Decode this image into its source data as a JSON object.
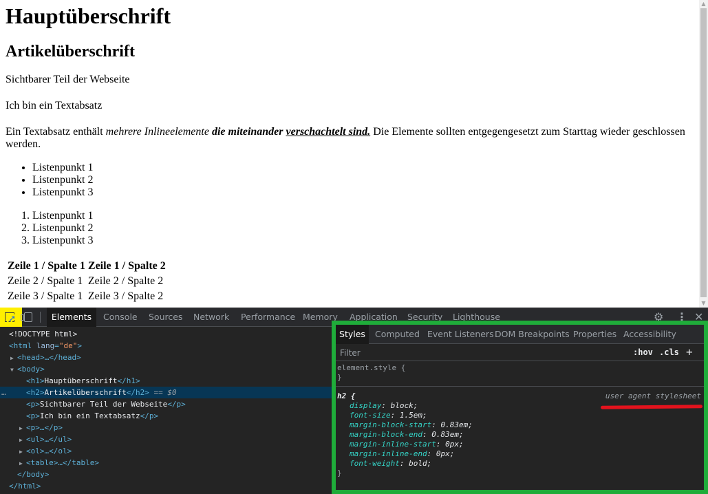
{
  "page": {
    "h1": "Hauptüberschrift",
    "h2": "Artikelüberschrift",
    "p1": "Sichtbarer Teil der Webseite",
    "p2": "Ich bin ein Textabsatz",
    "p3": {
      "part1": "Ein Textabsatz enthält ",
      "em": "mehrere Inlineelemente",
      "space1": " ",
      "strong": "die miteinander ",
      "strong_u": "verschachtelt sind.",
      "part2": " Die Elemente sollten entgegengesetzt zum Starttag wieder geschlossen werden."
    },
    "ul": [
      "Listenpunkt 1",
      "Listenpunkt 2",
      "Listenpunkt 3"
    ],
    "ol": [
      "Listenpunkt 1",
      "Listenpunkt 2",
      "Listenpunkt 3"
    ],
    "table": {
      "headers": [
        "Zeile 1 / Spalte 1",
        "Zeile 1 / Spalte 2"
      ],
      "rows": [
        [
          "Zeile 2 / Spalte 1",
          "Zeile 2 / Spalte 2"
        ],
        [
          "Zeile 3 / Spalte 1",
          "Zeile 3 / Spalte 2"
        ]
      ]
    }
  },
  "devtools": {
    "tabs": [
      "Elements",
      "Console",
      "Sources",
      "Network",
      "Performance",
      "Memory",
      "Application",
      "Security",
      "Lighthouse"
    ],
    "active_tab": "Elements",
    "icons": {
      "inspect": "inspect-element-icon",
      "device": "device-toolbar-icon",
      "settings": "gear-icon",
      "more": "kebab-menu-icon",
      "close": "close-icon"
    },
    "colors": {
      "inspect_highlight": "#ffef00",
      "styles_panel_border": "#1fac3a",
      "annotation_underline": "#e3131d"
    },
    "tree": {
      "doctype": "<!DOCTYPE html>",
      "html_open_tag": "html",
      "html_attr_name": "lang",
      "html_attr_value": "\"de\"",
      "head_collapsed": "<head>…</head>",
      "body_open": "<body>",
      "h1_tag": "h1",
      "h1_text": "Hauptüberschrift",
      "h2_tag": "h2",
      "h2_text": "Artikelüberschrift",
      "selected_marker": "== $0",
      "p1_text": "Sichtbarer Teil der Webseite",
      "p2_text": "Ich bin ein Textabsatz",
      "p_collapsed": "<p>…</p>",
      "ul_collapsed": "<ul>…</ul>",
      "ol_collapsed": "<ol>…</ol>",
      "table_collapsed": "<table>…</table>",
      "body_close": "</body>",
      "html_close": "</html>",
      "gutter": "…"
    },
    "styles": {
      "tabs": [
        "Styles",
        "Computed",
        "Event Listeners",
        "DOM Breakpoints",
        "Properties",
        "Accessibility"
      ],
      "active_tab": "Styles",
      "filter_placeholder": "Filter",
      "hov": ":hov",
      "cls": ".cls",
      "add": "+",
      "element_style": "element.style {",
      "close_brace": "}",
      "h2_selector": "h2 {",
      "source": "user agent stylesheet",
      "declarations": [
        {
          "prop": "display",
          "val": "block;"
        },
        {
          "prop": "font-size",
          "val": "1.5em;"
        },
        {
          "prop": "margin-block-start",
          "val": "0.83em;"
        },
        {
          "prop": "margin-block-end",
          "val": "0.83em;"
        },
        {
          "prop": "margin-inline-start",
          "val": "0px;"
        },
        {
          "prop": "margin-inline-end",
          "val": "0px;"
        },
        {
          "prop": "font-weight",
          "val": "bold;"
        }
      ]
    }
  }
}
